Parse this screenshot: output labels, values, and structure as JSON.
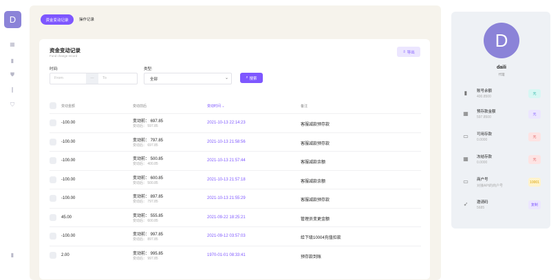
{
  "sidebar": {
    "logo": "D",
    "icons": [
      "grid-icon",
      "bar-chart-icon",
      "shield-icon",
      "book-icon",
      "shield-alt-icon"
    ],
    "bottom_icon": "bar-chart-icon"
  },
  "tabs": [
    {
      "label": "资金变动记录",
      "active": true
    },
    {
      "label": "操作记录",
      "active": false
    }
  ],
  "card": {
    "title": "资金变动记录",
    "subtitle": "Fund change record",
    "export_label": "导出"
  },
  "filters": {
    "time_label": "时间:",
    "from_placeholder": "From",
    "separator": "—",
    "to_placeholder": "To",
    "type_label": "类型:",
    "type_value": "全部",
    "search_label": "搜索"
  },
  "table": {
    "headers": [
      "变动金额",
      "变动前后",
      "变动时间",
      "备注"
    ],
    "rows": [
      {
        "amount": "-100.00",
        "before": "变动前： 697.85",
        "after": "变动后： 597.85",
        "time": "2021-10-13 22:14:23",
        "note": "客服减款预存款"
      },
      {
        "amount": "-100.00",
        "before": "变动前： 797.85",
        "after": "变动后： 697.85",
        "time": "2021-10-13 21:58:56",
        "note": "客服减款预存款"
      },
      {
        "amount": "-100.00",
        "before": "变动前： 500.85",
        "after": "变动后： 400.85",
        "time": "2021-10-13 21:57:44",
        "note": "客服减款余额"
      },
      {
        "amount": "-100.00",
        "before": "变动前： 600.85",
        "after": "变动后： 500.85",
        "time": "2021-10-13 21:57:18",
        "note": "客服减款余额"
      },
      {
        "amount": "-100.00",
        "before": "变动前： 897.85",
        "after": "变动后： 797.85",
        "time": "2021-10-13 21:55:29",
        "note": "客服减款预存款"
      },
      {
        "amount": "45.00",
        "before": "变动前： 555.85",
        "after": "变动后： 600.85",
        "time": "2021-09-22 18:25:21",
        "note": "管理员变更金额"
      },
      {
        "amount": "-100.00",
        "before": "变动前： 997.85",
        "after": "变动后： 897.85",
        "time": "2021-09-12 03:57:03",
        "note": "给下级10004充值扣款"
      },
      {
        "amount": "2.00",
        "before": "变动前： 995.85",
        "after": "变动后： 997.85",
        "time": "1970-01-01 08:33:41",
        "note": "预存款到账"
      }
    ]
  },
  "profile": {
    "avatar": "D",
    "name": "daili",
    "role": "代理",
    "items": [
      {
        "icon": "bar-chart-icon",
        "title": "账号余额",
        "value": "400.8500",
        "badge": "元",
        "badge_bg": "#d7f7f3",
        "badge_fg": "#23b3a3"
      },
      {
        "icon": "grid-icon",
        "title": "预存款金额",
        "value": "597.8500",
        "badge": "元",
        "badge_bg": "#ece6ff",
        "badge_fg": "#7e57ff"
      },
      {
        "icon": "card-icon",
        "title": "可用存款",
        "value": "0.0000",
        "badge": "元",
        "badge_bg": "#fde3e3",
        "badge_fg": "#e05a5a"
      },
      {
        "icon": "grid-icon",
        "title": "冻结存款",
        "value": "0.0000",
        "badge": "元",
        "badge_bg": "#fde3e3",
        "badge_fg": "#e05a5a"
      },
      {
        "icon": "card-icon",
        "title": "商户号",
        "value": "对接API的商户号",
        "badge": "10001",
        "badge_bg": "#fff3cc",
        "badge_fg": "#d9a300"
      },
      {
        "icon": "share-icon",
        "title": "邀请码",
        "value": "5685",
        "badge": "复制",
        "badge_bg": "#ece6ff",
        "badge_fg": "#7e57ff"
      }
    ]
  }
}
